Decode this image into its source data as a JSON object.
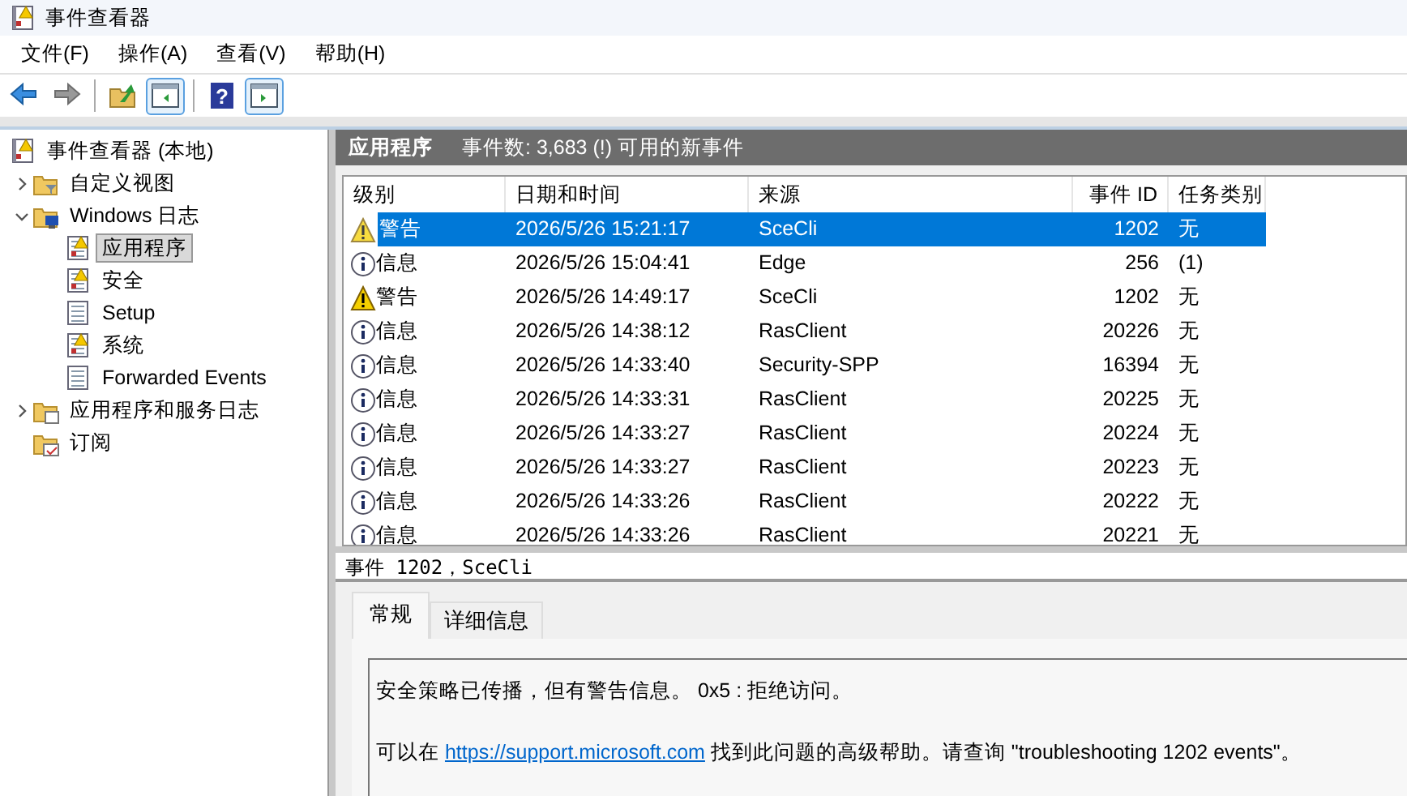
{
  "window": {
    "title": "事件查看器"
  },
  "menu": [
    "文件(F)",
    "操作(A)",
    "查看(V)",
    "帮助(H)"
  ],
  "toolbar": [
    {
      "kind": "back",
      "disabled": false,
      "pressed": false
    },
    {
      "kind": "forward",
      "disabled": true,
      "pressed": false
    },
    {
      "kind": "sep"
    },
    {
      "kind": "folder-up",
      "disabled": false,
      "pressed": false
    },
    {
      "kind": "tree-pane",
      "disabled": false,
      "pressed": true
    },
    {
      "kind": "sep"
    },
    {
      "kind": "help",
      "glyph": "?",
      "disabled": false,
      "pressed": false
    },
    {
      "kind": "action-pane",
      "disabled": false,
      "pressed": true
    }
  ],
  "tree": [
    {
      "label": "事件查看器 (本地)",
      "kind": "viewer",
      "selected": false,
      "children": [
        {
          "label": "自定义视图",
          "kind": "folder-filter",
          "expanded": false,
          "selected": false
        },
        {
          "label": "Windows 日志",
          "kind": "folder-windows",
          "expanded": true,
          "selected": false,
          "children": [
            {
              "label": "应用程序",
              "kind": "log-warn",
              "selected": true
            },
            {
              "label": "安全",
              "kind": "log-warn",
              "selected": false
            },
            {
              "label": "Setup",
              "kind": "log",
              "selected": false
            },
            {
              "label": "系统",
              "kind": "log-warn",
              "selected": false
            },
            {
              "label": "Forwarded Events",
              "kind": "log",
              "selected": false
            }
          ]
        },
        {
          "label": "应用程序和服务日志",
          "kind": "folder-log",
          "expanded": false,
          "selected": false
        },
        {
          "label": "订阅",
          "kind": "folder-sub",
          "selected": false
        }
      ]
    }
  ],
  "log_header": {
    "title": "应用程序",
    "summary": "事件数: 3,683 (!) 可用的新事件"
  },
  "table": {
    "columns": [
      "级别",
      "日期和时间",
      "来源",
      "事件 ID",
      "任务类别"
    ],
    "rows": [
      {
        "kind": "warning",
        "level": "警告",
        "date": "2026/5/26 15:21:17",
        "source": "SceCli",
        "id": "1202",
        "task": "无",
        "selected": true
      },
      {
        "kind": "info",
        "level": "信息",
        "date": "2026/5/26 15:04:41",
        "source": "Edge",
        "id": "256",
        "task": "(1)",
        "selected": false
      },
      {
        "kind": "warning",
        "level": "警告",
        "date": "2026/5/26 14:49:17",
        "source": "SceCli",
        "id": "1202",
        "task": "无",
        "selected": false
      },
      {
        "kind": "info",
        "level": "信息",
        "date": "2026/5/26 14:38:12",
        "source": "RasClient",
        "id": "20226",
        "task": "无",
        "selected": false
      },
      {
        "kind": "info",
        "level": "信息",
        "date": "2026/5/26 14:33:40",
        "source": "Security-SPP",
        "id": "16394",
        "task": "无",
        "selected": false
      },
      {
        "kind": "info",
        "level": "信息",
        "date": "2026/5/26 14:33:31",
        "source": "RasClient",
        "id": "20225",
        "task": "无",
        "selected": false
      },
      {
        "kind": "info",
        "level": "信息",
        "date": "2026/5/26 14:33:27",
        "source": "RasClient",
        "id": "20224",
        "task": "无",
        "selected": false
      },
      {
        "kind": "info",
        "level": "信息",
        "date": "2026/5/26 14:33:27",
        "source": "RasClient",
        "id": "20223",
        "task": "无",
        "selected": false
      },
      {
        "kind": "info",
        "level": "信息",
        "date": "2026/5/26 14:33:26",
        "source": "RasClient",
        "id": "20222",
        "task": "无",
        "selected": false
      },
      {
        "kind": "info",
        "level": "信息",
        "date": "2026/5/26 14:33:26",
        "source": "RasClient",
        "id": "20221",
        "task": "无",
        "selected": false
      }
    ]
  },
  "detail": {
    "title": "事件 1202，SceCli",
    "tabs": [
      {
        "label": "常规",
        "selected": true
      },
      {
        "label": "详细信息",
        "selected": false
      }
    ],
    "message": "安全策略已传播，但有警告信息。 0x5 : 拒绝访问。",
    "help_prefix": "可以在 ",
    "help_link": "https://support.microsoft.com",
    "help_suffix": " 找到此问题的高级帮助。请查询 \"troubleshooting 1202 events\"。"
  }
}
